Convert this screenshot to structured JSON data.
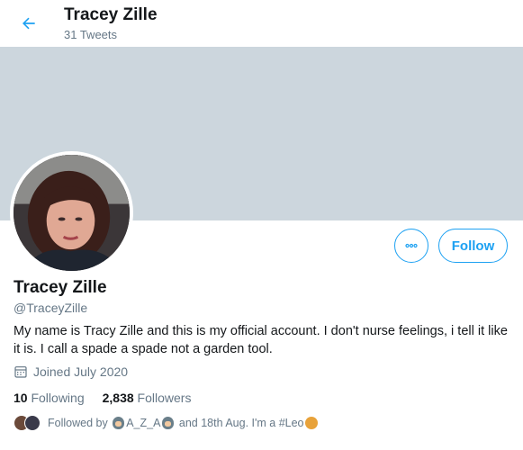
{
  "header": {
    "title": "Tracey Zille",
    "subtitle": "31 Tweets"
  },
  "profile": {
    "name": "Tracey Zille",
    "handle": "@TraceyZille",
    "bio": "My name is Tracy Zille and this is my official account. I don't nurse feelings, i tell it like it is. I call a spade a spade not a garden tool.",
    "joined": "Joined July 2020",
    "following_count": "10",
    "following_label": "Following",
    "followers_count": "2,838",
    "followers_label": "Followers",
    "followed_by_prefix": "Followed by",
    "followed_by_name": "A_Z_A",
    "followed_by_suffix": "and 18th Aug. I'm a #Leo"
  },
  "actions": {
    "follow_label": "Follow"
  },
  "colors": {
    "accent": "#1da1f2",
    "banner": "#ccd6dd",
    "secondary_text": "#657786"
  },
  "icons": [
    "back-arrow-icon",
    "more-options-icon",
    "calendar-icon"
  ]
}
